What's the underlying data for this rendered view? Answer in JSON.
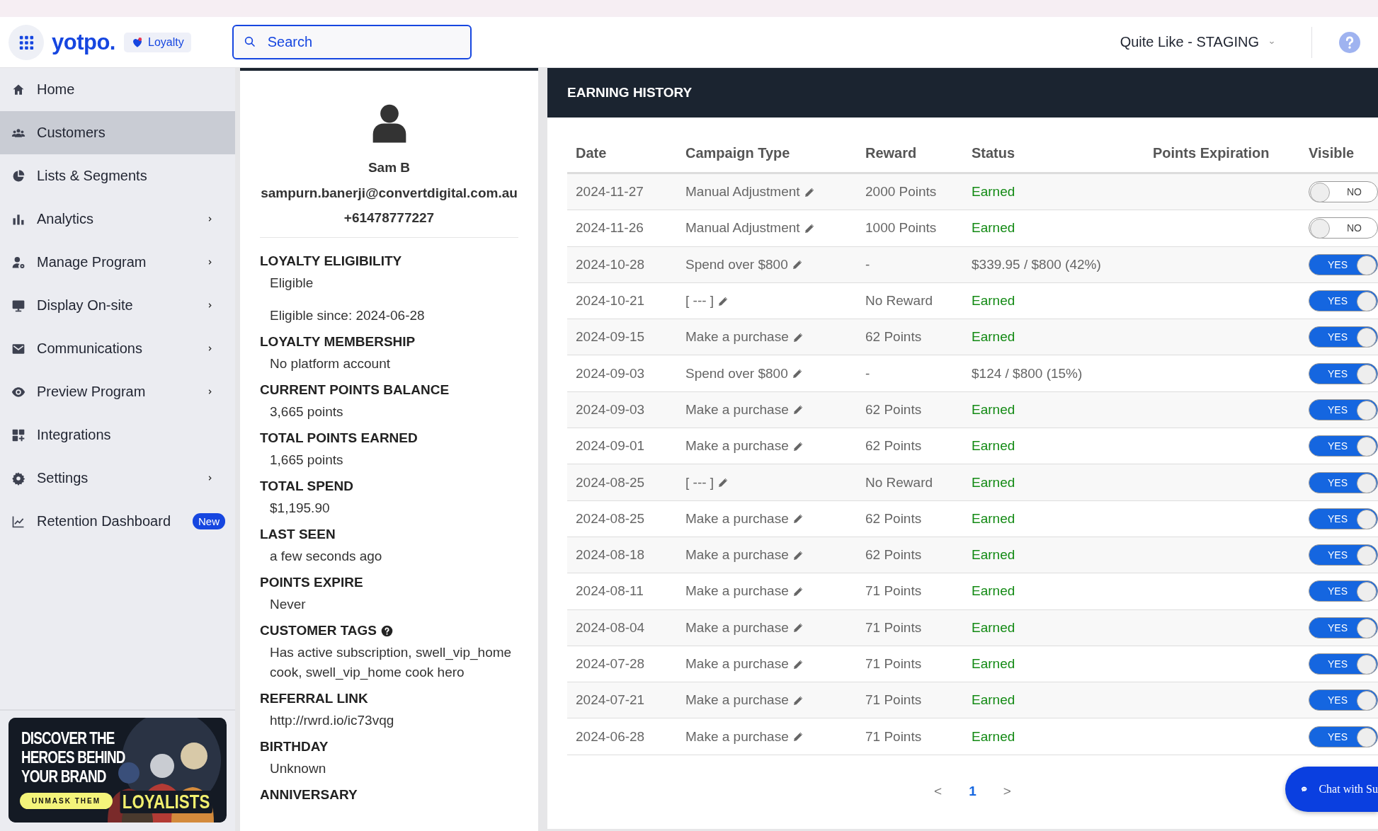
{
  "header": {
    "logo": "yotpo.",
    "product_badge": "Loyalty",
    "search": {
      "placeholder": "Search"
    },
    "store_selector": "Quite Like - STAGING"
  },
  "sidebar": {
    "items": [
      {
        "label": "Home",
        "selected": false,
        "has_submenu": false
      },
      {
        "label": "Customers",
        "selected": true,
        "has_submenu": false
      },
      {
        "label": "Lists & Segments",
        "selected": false,
        "has_submenu": false
      },
      {
        "label": "Analytics",
        "selected": false,
        "has_submenu": true
      },
      {
        "label": "Manage Program",
        "selected": false,
        "has_submenu": true
      },
      {
        "label": "Display On-site",
        "selected": false,
        "has_submenu": true
      },
      {
        "label": "Communications",
        "selected": false,
        "has_submenu": true
      },
      {
        "label": "Preview Program",
        "selected": false,
        "has_submenu": true
      },
      {
        "label": "Integrations",
        "selected": false,
        "has_submenu": false
      },
      {
        "label": "Settings",
        "selected": false,
        "has_submenu": true
      },
      {
        "label": "Retention Dashboard",
        "selected": false,
        "has_submenu": false,
        "badge": "New"
      }
    ],
    "promo_banner": {
      "headline": [
        "DISCOVER THE",
        "HEROES BEHIND",
        "YOUR BRAND"
      ],
      "button": "UNMASK THEM",
      "tagline": "LOYALISTS"
    }
  },
  "customer": {
    "name": "Sam B",
    "email": "sampurn.banerji@convertdigital.com.au",
    "phone": "+61478777227",
    "sections": [
      {
        "label": "LOYALTY ELIGIBILITY",
        "values": [
          "Eligible",
          "Eligible since: 2024-06-28"
        ]
      },
      {
        "label": "LOYALTY MEMBERSHIP",
        "values": [
          "No platform account"
        ]
      },
      {
        "label": "CURRENT POINTS BALANCE",
        "values": [
          "3,665 points"
        ]
      },
      {
        "label": "TOTAL POINTS EARNED",
        "values": [
          "1,665 points"
        ]
      },
      {
        "label": "TOTAL SPEND",
        "values": [
          "$1,195.90"
        ]
      },
      {
        "label": "LAST SEEN",
        "values": [
          "a few seconds ago"
        ]
      },
      {
        "label": "POINTS EXPIRE",
        "values": [
          "Never"
        ]
      },
      {
        "label": "CUSTOMER TAGS",
        "help": true,
        "values": [
          "Has active subscription, swell_vip_home cook, swell_vip_home cook hero"
        ]
      },
      {
        "label": "REFERRAL LINK",
        "values": [
          "http://rwrd.io/ic73vqg"
        ]
      },
      {
        "label": "BIRTHDAY",
        "values": [
          "Unknown"
        ]
      },
      {
        "label": "ANNIVERSARY"
      }
    ]
  },
  "earning_history": {
    "title": "EARNING HISTORY",
    "columns": [
      "Date",
      "Campaign Type",
      "Reward",
      "Status",
      "Points Expiration",
      "Visible"
    ],
    "rows": [
      {
        "date": "2024-11-27",
        "campaign": "Manual Adjustment",
        "reward": "2000 Points",
        "status": "Earned",
        "color": "#138a14",
        "visible": false,
        "toggle_label": "NO"
      },
      {
        "date": "2024-11-26",
        "campaign": "Manual Adjustment",
        "reward": "1000 Points",
        "status": "Earned",
        "color": "#138a14",
        "visible": false,
        "toggle_label": "NO"
      },
      {
        "date": "2024-10-28",
        "campaign": "Spend over $800",
        "reward": "-",
        "status": "$339.95 / $800 (42%)",
        "color": "#666666",
        "visible": true,
        "toggle_label": "YES"
      },
      {
        "date": "2024-10-21",
        "campaign": "[ --- ]",
        "reward": "No Reward",
        "status": "Earned",
        "color": "#138a14",
        "visible": true,
        "toggle_label": "YES"
      },
      {
        "date": "2024-09-15",
        "campaign": "Make a purchase",
        "reward": "62 Points",
        "status": "Earned",
        "color": "#138a14",
        "visible": true,
        "toggle_label": "YES"
      },
      {
        "date": "2024-09-03",
        "campaign": "Spend over $800",
        "reward": "-",
        "status": "$124 / $800 (15%)",
        "color": "#666666",
        "visible": true,
        "toggle_label": "YES"
      },
      {
        "date": "2024-09-03",
        "campaign": "Make a purchase",
        "reward": "62 Points",
        "status": "Earned",
        "color": "#138a14",
        "visible": true,
        "toggle_label": "YES"
      },
      {
        "date": "2024-09-01",
        "campaign": "Make a purchase",
        "reward": "62 Points",
        "status": "Earned",
        "color": "#138a14",
        "visible": true,
        "toggle_label": "YES"
      },
      {
        "date": "2024-08-25",
        "campaign": "[ --- ]",
        "reward": "No Reward",
        "status": "Earned",
        "color": "#138a14",
        "visible": true,
        "toggle_label": "YES"
      },
      {
        "date": "2024-08-25",
        "campaign": "Make a purchase",
        "reward": "62 Points",
        "status": "Earned",
        "color": "#138a14",
        "visible": true,
        "toggle_label": "YES"
      },
      {
        "date": "2024-08-18",
        "campaign": "Make a purchase",
        "reward": "62 Points",
        "status": "Earned",
        "color": "#138a14",
        "visible": true,
        "toggle_label": "YES"
      },
      {
        "date": "2024-08-11",
        "campaign": "Make a purchase",
        "reward": "71 Points",
        "status": "Earned",
        "color": "#138a14",
        "visible": true,
        "toggle_label": "YES"
      },
      {
        "date": "2024-08-04",
        "campaign": "Make a purchase",
        "reward": "71 Points",
        "status": "Earned",
        "color": "#138a14",
        "visible": true,
        "toggle_label": "YES"
      },
      {
        "date": "2024-07-28",
        "campaign": "Make a purchase",
        "reward": "71 Points",
        "status": "Earned",
        "color": "#138a14",
        "visible": true,
        "toggle_label": "YES"
      },
      {
        "date": "2024-07-21",
        "campaign": "Make a purchase",
        "reward": "71 Points",
        "status": "Earned",
        "color": "#138a14",
        "visible": true,
        "toggle_label": "YES"
      },
      {
        "date": "2024-06-28",
        "campaign": "Make a purchase",
        "reward": "71 Points",
        "status": "Earned",
        "color": "#138a14",
        "visible": true,
        "toggle_label": "YES"
      }
    ],
    "pagination": {
      "prev": "<",
      "pages": [
        {
          "label": "1",
          "selected": true
        }
      ],
      "next": ">"
    }
  },
  "chat_button": "Chat with Su"
}
